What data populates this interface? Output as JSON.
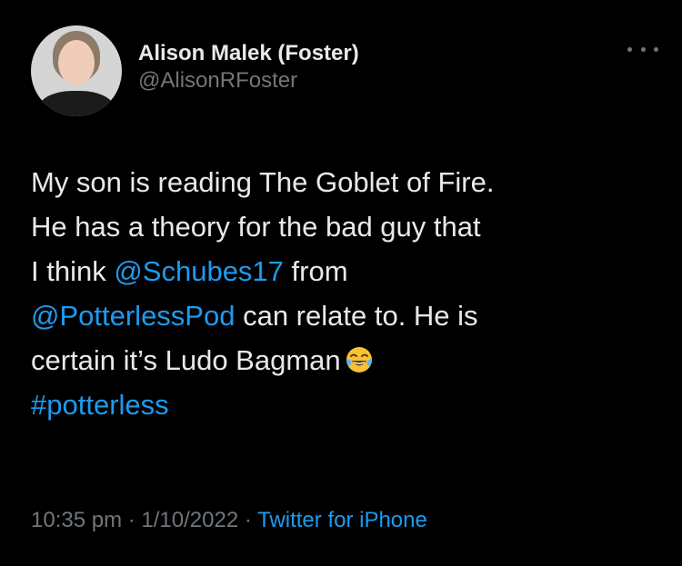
{
  "user": {
    "display_name": "Alison Malek (Foster)",
    "handle": "@AlisonRFoster"
  },
  "tweet": {
    "line1": "My son is reading The Goblet of Fire.",
    "line2": "He has a theory for the bad guy that",
    "line3_prefix": "I think ",
    "mention1": "@Schubes17",
    "line3_suffix": " from",
    "mention2": "@PotterlessPod",
    "line4_suffix": " can relate to. He is",
    "line5": "certain it’s Ludo Bagman",
    "hashtag": "#potterless"
  },
  "meta": {
    "time": "10:35 pm",
    "date": "1/10/2022",
    "separator": " · ",
    "source": "Twitter for iPhone"
  },
  "colors": {
    "background": "#000000",
    "text": "#e7e9ea",
    "secondary": "#71767b",
    "link": "#1d9bf0"
  },
  "icons": {
    "more": "more-horizontal-icon",
    "emoji": "face-with-tears-of-joy-emoji"
  }
}
